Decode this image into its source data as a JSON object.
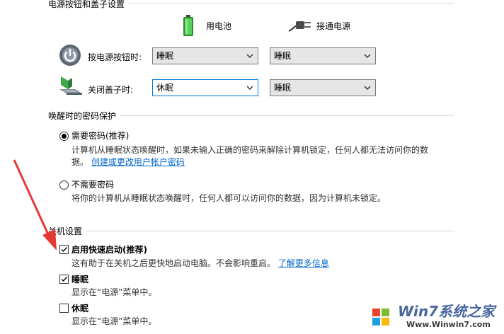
{
  "power_buttons": {
    "section_title": "电源按钮和盖子设置",
    "battery_header": "用电池",
    "plugged_header": "接通电源",
    "rows": [
      {
        "label": "按电源按钮时:",
        "battery_value": "睡眠",
        "plugged_value": "睡眠"
      },
      {
        "label": "关闭盖子时:",
        "battery_value": "休眠",
        "plugged_value": "睡眠"
      }
    ]
  },
  "password": {
    "section_title": "唤醒时的密码保护",
    "require": {
      "label": "需要密码(推荐)",
      "desc_line1": "计算机从睡眠状态唤醒时，如果未输入正确的密码来解除计算机锁定，任何人都无法访问你的数",
      "desc_line2_prefix": "据。",
      "link": "创建或更改用户帐户密码",
      "selected": true
    },
    "no_require": {
      "label": "不需要密码",
      "desc": "将你的计算机从睡眠状态唤醒时，任何人都可以访问你的数据，因为计算机未锁定。",
      "selected": false
    }
  },
  "shutdown": {
    "section_title": "关机设置",
    "items": [
      {
        "label": "启用快速启动(推荐)",
        "desc": "这有助于在关机之后更快地启动电脑。不会影响重启。",
        "link": "了解更多信息",
        "checked": true
      },
      {
        "label": "睡眠",
        "desc": "显示在“电源”菜单中。",
        "checked": true
      },
      {
        "label": "休眠",
        "desc": "显示在“电源”菜单中。",
        "checked": false
      }
    ]
  },
  "watermark": {
    "brand": "Win7系统之家",
    "url": "Www.Winwin7.com"
  },
  "colors": {
    "link": "#0066cc",
    "focus_border": "#0078d7",
    "arrow": "#e53935",
    "battery": "#3fbf3f"
  }
}
